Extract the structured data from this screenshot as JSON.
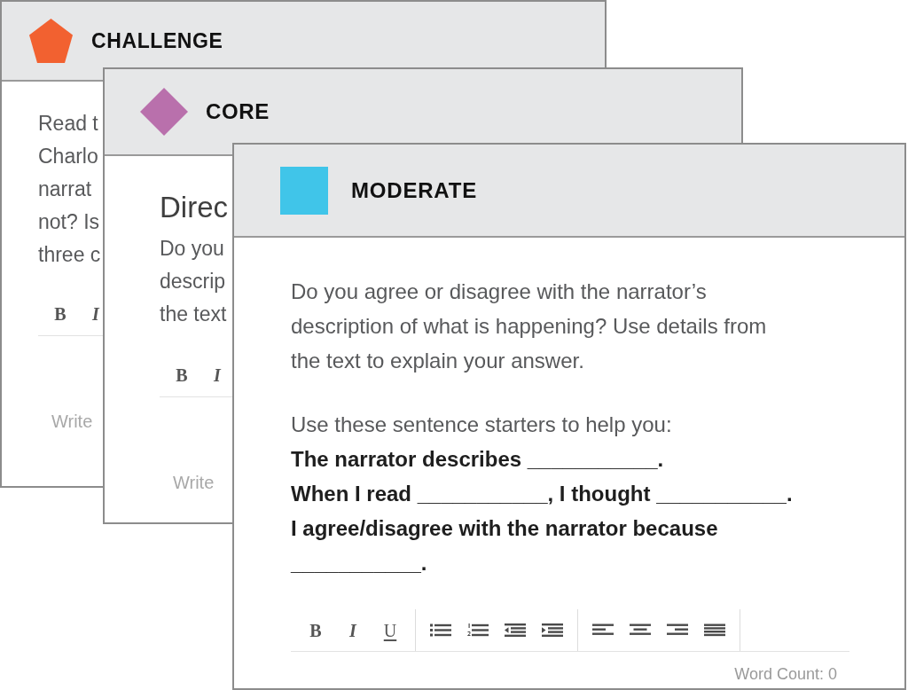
{
  "cards": [
    {
      "title": "CHALLENGE",
      "color": "#f26130",
      "text_lines": [
        "Read t",
        "Charlo",
        "narrat",
        "not? Is",
        "three c"
      ],
      "toolbar": [
        {
          "kind": "bold",
          "label": "B"
        },
        {
          "kind": "italic",
          "label": "I"
        }
      ],
      "placeholder": "Write"
    },
    {
      "title": "CORE",
      "color": "#b970ac",
      "heading": "Direc",
      "text_lines": [
        "Do you",
        "descrip",
        "the text"
      ],
      "toolbar": [
        {
          "kind": "bold",
          "label": "B"
        },
        {
          "kind": "italic",
          "label": "I"
        }
      ],
      "placeholder": "Write"
    },
    {
      "title": "MODERATE",
      "color": "#40c5e9",
      "prompt": "Do you agree or disagree with the narrator’s description of what is happening? Use details from the text to explain your answer.",
      "starters_intro": "Use these sentence starters to help you:",
      "starters": [
        "The narrator describes ___________.",
        "When I read ___________, I thought ___________.",
        "I agree/disagree with the narrator because ___________."
      ],
      "toolbar": [
        {
          "kind": "bold",
          "label": "B"
        },
        {
          "kind": "italic",
          "label": "I"
        },
        {
          "kind": "underline",
          "label": "U"
        }
      ],
      "word_count": "Word Count: 0"
    }
  ]
}
